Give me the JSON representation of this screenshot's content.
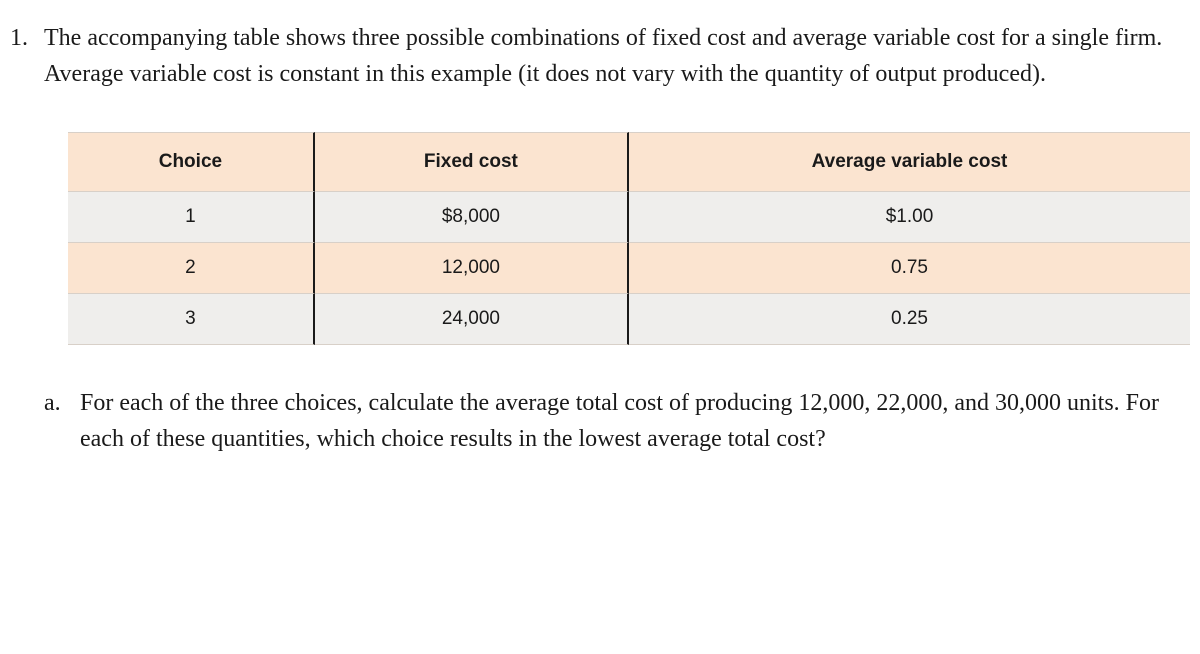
{
  "question": {
    "number": "1.",
    "text": "The accompanying table shows three possible combinations of fixed cost and average variable cost for a single firm. Average variable cost is constant in this example (it does not vary with the quantity of output produced)."
  },
  "table": {
    "headers": [
      "Choice",
      "Fixed cost",
      "Average variable cost"
    ],
    "rows": [
      {
        "choice": "1",
        "fixed_cost": "$8,000",
        "avc": "$1.00"
      },
      {
        "choice": "2",
        "fixed_cost": "12,000",
        "avc": "0.75"
      },
      {
        "choice": "3",
        "fixed_cost": "24,000",
        "avc": "0.25"
      }
    ]
  },
  "sub_question": {
    "letter": "a.",
    "text": "For each of the three choices, calculate the average total cost of producing 12,000, 22,000, and 30,000 units. For each of these quantities, which choice results in the lowest average total cost?"
  }
}
